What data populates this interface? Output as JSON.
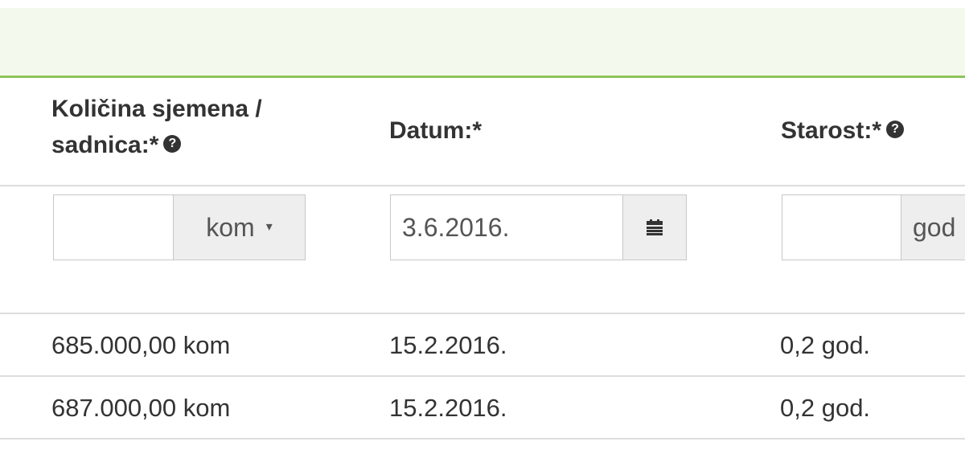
{
  "columns": {
    "quantity": {
      "label_line1": "Količina sjemena /",
      "label_line2": "sadnica:*",
      "input_value": "",
      "unit_select": "kom",
      "unit_caret": "▾"
    },
    "date": {
      "label": "Datum:*",
      "input_value": "3.6.2016."
    },
    "age": {
      "label": "Starost:*",
      "input_value": "",
      "unit_select": "god"
    }
  },
  "help_glyph": "?",
  "rows": [
    {
      "quantity": "685.000,00 kom",
      "date": "15.2.2016.",
      "age": "0,2 god."
    },
    {
      "quantity": "687.000,00 kom",
      "date": "15.2.2016.",
      "age": "0,2 god."
    }
  ],
  "colors": {
    "banner_bg": "#f3f9ec",
    "banner_border": "#8cc55a",
    "addon_bg": "#eeeeee",
    "text": "#333333"
  },
  "icons": {
    "help": "question-circle-icon",
    "calendar": "calendar-icon",
    "dropdown": "caret-down-icon"
  }
}
